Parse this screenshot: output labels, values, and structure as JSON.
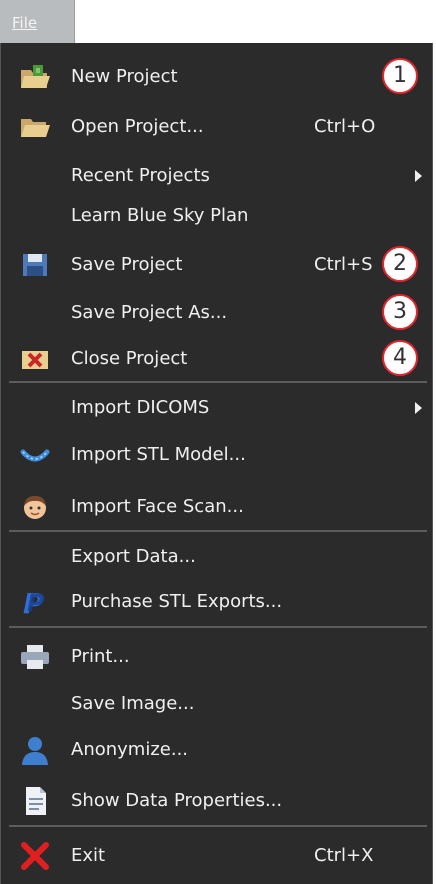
{
  "menu_bar": {
    "file_label": "File"
  },
  "items": [
    {
      "label": "New Project",
      "shortcut": "",
      "icon": "new-project-folder-icon",
      "badge": "1"
    },
    {
      "label": "Open Project...",
      "shortcut": "Ctrl+O",
      "icon": "open-folder-icon"
    },
    {
      "label": "Recent Projects",
      "shortcut": "",
      "submenu": true
    },
    {
      "label": "Learn Blue Sky Plan",
      "shortcut": ""
    },
    {
      "label": "Save Project",
      "shortcut": "Ctrl+S",
      "icon": "floppy-disk-icon",
      "badge": "2"
    },
    {
      "label": "Save Project As...",
      "shortcut": "",
      "badge": "3"
    },
    {
      "label": "Close Project",
      "shortcut": "",
      "icon": "close-project-icon",
      "badge": "4"
    },
    {
      "label": "Import DICOMS",
      "shortcut": "",
      "submenu": true
    },
    {
      "label": "Import STL Model...",
      "shortcut": "",
      "icon": "dental-arch-icon"
    },
    {
      "label": "Import Face Scan...",
      "shortcut": "",
      "icon": "face-icon"
    },
    {
      "label": "Export Data...",
      "shortcut": ""
    },
    {
      "label": "Purchase STL Exports...",
      "shortcut": "",
      "icon": "paypal-icon"
    },
    {
      "label": "Print...",
      "shortcut": "",
      "icon": "printer-icon"
    },
    {
      "label": "Save Image...",
      "shortcut": ""
    },
    {
      "label": "Anonymize...",
      "shortcut": "",
      "icon": "person-silhouette-icon"
    },
    {
      "label": "Show Data Properties...",
      "shortcut": "",
      "icon": "document-icon"
    },
    {
      "label": "Exit",
      "shortcut": "Ctrl+X",
      "icon": "red-x-icon"
    }
  ],
  "colors": {
    "menu_bg": "#2b2b2b",
    "text": "#f0f0f0",
    "badge_border": "#e3262c",
    "separator": "#5c5c5c"
  }
}
